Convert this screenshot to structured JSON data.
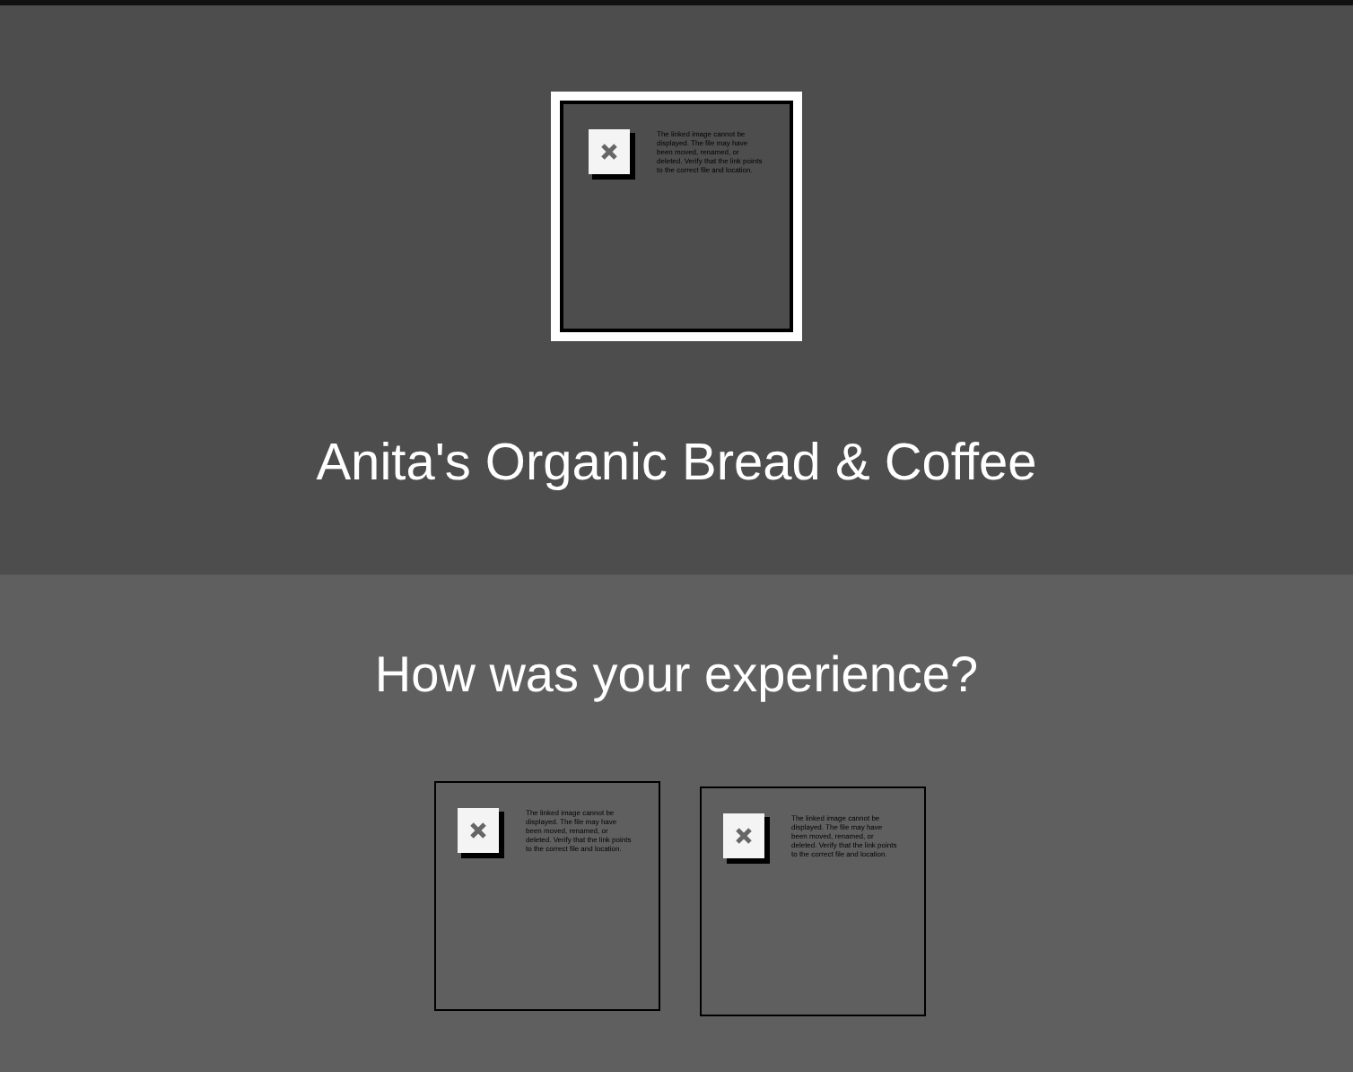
{
  "header": {
    "logo": {
      "kind": "broken_image",
      "message": "The linked image cannot be displayed. The file may have been moved, renamed, or deleted. Verify that the link points to the correct file and location."
    },
    "title": "Anita's Organic Bread & Coffee"
  },
  "survey": {
    "question": "How was your experience?",
    "options": [
      {
        "kind": "broken_image",
        "message": "The linked image cannot be displayed. The file may have been moved, renamed, or deleted. Verify that the link points to the correct file and location."
      },
      {
        "kind": "broken_image",
        "message": "The linked image cannot be displayed. The file may have been moved, renamed, or deleted. Verify that the link points to the correct file and location."
      }
    ]
  }
}
